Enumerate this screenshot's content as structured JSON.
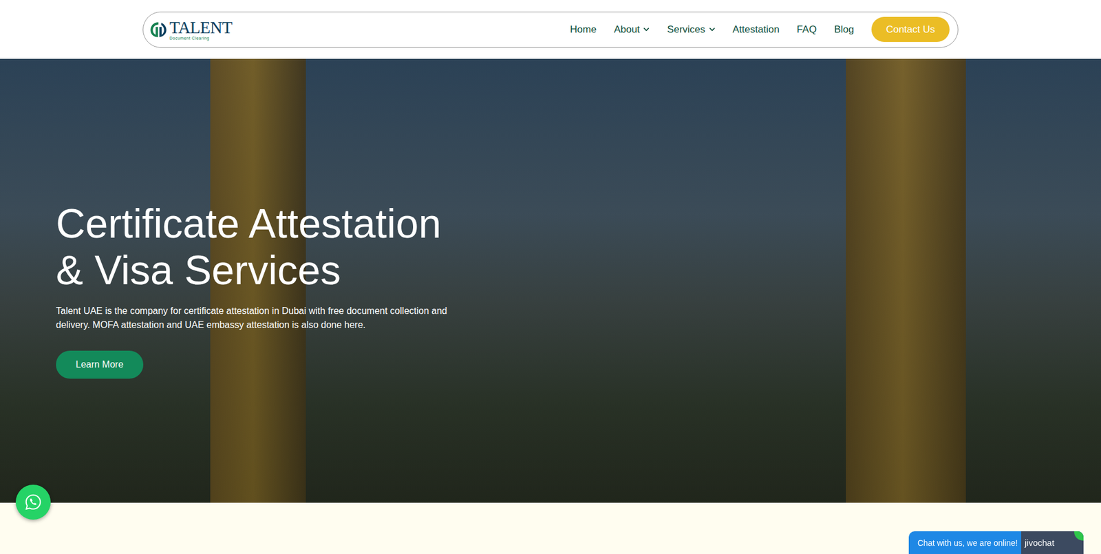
{
  "header": {
    "logo": {
      "name": "TALENT",
      "tagline": "Document Clearing"
    },
    "nav": [
      {
        "label": "Home",
        "dropdown": false
      },
      {
        "label": "About",
        "dropdown": true
      },
      {
        "label": "Services",
        "dropdown": true
      },
      {
        "label": "Attestation",
        "dropdown": false
      },
      {
        "label": "FAQ",
        "dropdown": false
      },
      {
        "label": "Blog",
        "dropdown": false
      }
    ],
    "contact_button": "Contact Us"
  },
  "hero": {
    "title": "Certificate Attestation & Visa Services",
    "text": "Talent UAE is the company for certificate attestation in Dubai with free document collection and delivery. MOFA attestation and UAE embassy attestation is also done here.",
    "button": "Learn More"
  },
  "chat": {
    "label": "Chat with us, we are online!",
    "brand": "jivochat"
  }
}
